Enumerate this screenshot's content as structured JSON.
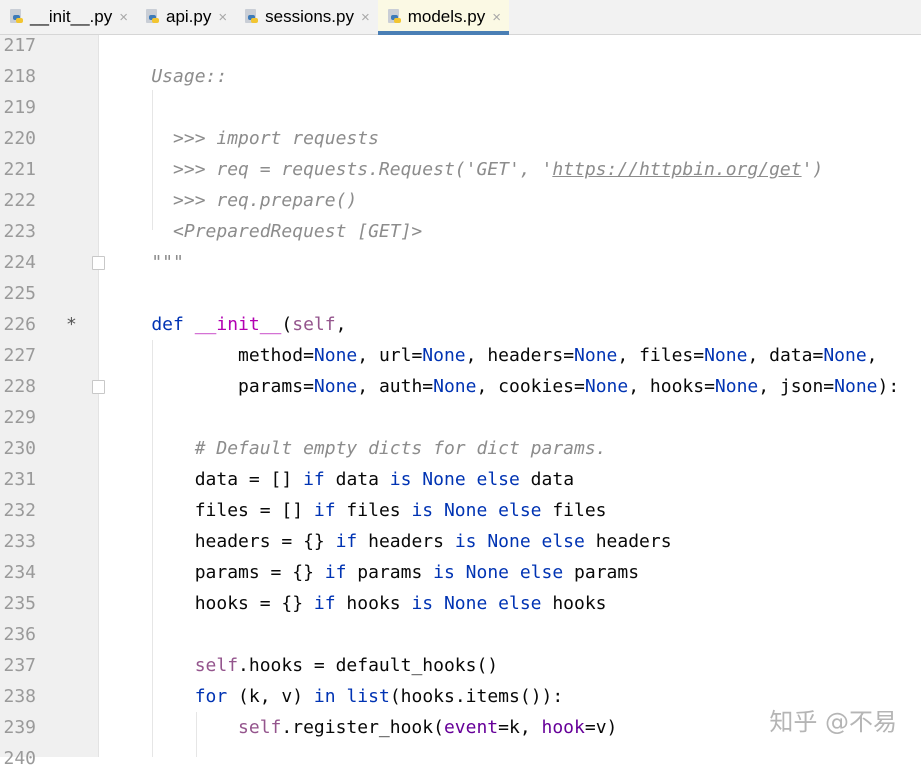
{
  "tabs": [
    {
      "label": "__init__.py",
      "active": false
    },
    {
      "label": "api.py",
      "active": false
    },
    {
      "label": "sessions.py",
      "active": false
    },
    {
      "label": "models.py",
      "active": true
    }
  ],
  "close_glyph": "×",
  "watermark": "知乎 @不易",
  "lines": [
    {
      "n": "217",
      "t": []
    },
    {
      "n": "218",
      "t": [
        [
          "doc",
          "    Usage::"
        ]
      ]
    },
    {
      "n": "219",
      "t": []
    },
    {
      "n": "220",
      "t": [
        [
          "doc",
          "      >>> import requests"
        ]
      ]
    },
    {
      "n": "221",
      "t": [
        [
          "doc",
          "      >>> req = requests.Request('GET', '"
        ],
        [
          "link",
          "https://httpbin.org/get"
        ],
        [
          "doc",
          "')"
        ]
      ]
    },
    {
      "n": "222",
      "t": [
        [
          "doc",
          "      >>> req.prepare()"
        ]
      ]
    },
    {
      "n": "223",
      "t": [
        [
          "doc",
          "      <PreparedRequest [GET]>"
        ]
      ]
    },
    {
      "n": "224",
      "fold": true,
      "t": [
        [
          "doc",
          "    \"\"\""
        ]
      ]
    },
    {
      "n": "225",
      "t": []
    },
    {
      "n": "226",
      "mark": "*",
      "t": [
        [
          "kw",
          "    def "
        ],
        [
          "magic",
          "__init__"
        ],
        [
          "t",
          "("
        ],
        [
          "self",
          "self"
        ],
        [
          "t",
          ","
        ]
      ]
    },
    {
      "n": "227",
      "t": [
        [
          "t",
          "            method="
        ],
        [
          "kw",
          "None"
        ],
        [
          "t",
          ", url="
        ],
        [
          "kw",
          "None"
        ],
        [
          "t",
          ", headers="
        ],
        [
          "kw",
          "None"
        ],
        [
          "t",
          ", files="
        ],
        [
          "kw",
          "None"
        ],
        [
          "t",
          ", data="
        ],
        [
          "kw",
          "None"
        ],
        [
          "t",
          ","
        ]
      ]
    },
    {
      "n": "228",
      "fold": true,
      "t": [
        [
          "t",
          "            params="
        ],
        [
          "kw",
          "None"
        ],
        [
          "t",
          ", auth="
        ],
        [
          "kw",
          "None"
        ],
        [
          "t",
          ", cookies="
        ],
        [
          "kw",
          "None"
        ],
        [
          "t",
          ", hooks="
        ],
        [
          "kw",
          "None"
        ],
        [
          "t",
          ", json="
        ],
        [
          "kw",
          "None"
        ],
        [
          "t",
          "):"
        ]
      ]
    },
    {
      "n": "229",
      "t": []
    },
    {
      "n": "230",
      "t": [
        [
          "cm",
          "        # Default empty dicts for dict params."
        ]
      ]
    },
    {
      "n": "231",
      "t": [
        [
          "t",
          "        data = [] "
        ],
        [
          "kw",
          "if"
        ],
        [
          "t",
          " data "
        ],
        [
          "kw",
          "is None else"
        ],
        [
          "t",
          " data"
        ]
      ]
    },
    {
      "n": "232",
      "t": [
        [
          "t",
          "        files = [] "
        ],
        [
          "kw",
          "if"
        ],
        [
          "t",
          " files "
        ],
        [
          "kw",
          "is None else"
        ],
        [
          "t",
          " files"
        ]
      ]
    },
    {
      "n": "233",
      "t": [
        [
          "t",
          "        headers = {} "
        ],
        [
          "kw",
          "if"
        ],
        [
          "t",
          " headers "
        ],
        [
          "kw",
          "is None else"
        ],
        [
          "t",
          " headers"
        ]
      ]
    },
    {
      "n": "234",
      "t": [
        [
          "t",
          "        params = {} "
        ],
        [
          "kw",
          "if"
        ],
        [
          "t",
          " params "
        ],
        [
          "kw",
          "is None else"
        ],
        [
          "t",
          " params"
        ]
      ]
    },
    {
      "n": "235",
      "t": [
        [
          "t",
          "        hooks = {} "
        ],
        [
          "kw",
          "if"
        ],
        [
          "t",
          " hooks "
        ],
        [
          "kw",
          "is None else"
        ],
        [
          "t",
          " hooks"
        ]
      ]
    },
    {
      "n": "236",
      "t": []
    },
    {
      "n": "237",
      "t": [
        [
          "self",
          "        self"
        ],
        [
          "t",
          ".hooks = default_hooks()"
        ]
      ]
    },
    {
      "n": "238",
      "t": [
        [
          "kw",
          "        for"
        ],
        [
          "t",
          " (k, v) "
        ],
        [
          "kw",
          "in"
        ],
        [
          "t",
          " "
        ],
        [
          "kw",
          "list"
        ],
        [
          "t",
          "(hooks.items()):"
        ]
      ]
    },
    {
      "n": "239",
      "t": [
        [
          "self",
          "            self"
        ],
        [
          "t",
          ".register_hook("
        ],
        [
          "arg",
          "event"
        ],
        [
          "t",
          "=k, "
        ],
        [
          "arg",
          "hook"
        ],
        [
          "t",
          "=v)"
        ]
      ]
    },
    {
      "n": "240",
      "t": []
    }
  ]
}
